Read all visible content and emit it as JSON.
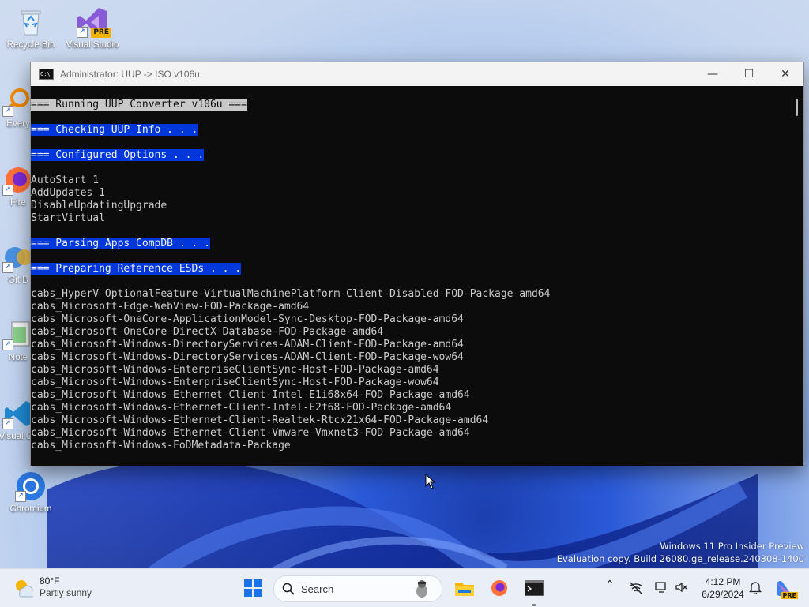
{
  "desktop": {
    "icons": [
      {
        "label": "Recycle Bin",
        "icon": "recycle-bin-icon"
      },
      {
        "label": "Visual Studio",
        "icon": "visual-studio-icon",
        "badge": "PRE"
      },
      {
        "label": "Every",
        "icon": "everything-icon"
      },
      {
        "label": "Fire",
        "icon": "firefox-icon"
      },
      {
        "label": "Git B",
        "icon": "git-bash-icon"
      },
      {
        "label": "Note",
        "icon": "notepad-icon"
      },
      {
        "label": "Visual Co",
        "icon": "vscode-icon"
      },
      {
        "label": "Chromium",
        "icon": "chromium-icon"
      }
    ],
    "watermark": {
      "line1": "Windows 11 Pro Insider Preview",
      "line2": "Evaluation copy. Build 26080.ge_release.240308-1400"
    }
  },
  "window": {
    "title": "Administrator:  UUP -> ISO v106u",
    "icon_text": "C:\\",
    "minimize": "—",
    "maximize": "☐",
    "close": "✕"
  },
  "console": {
    "lines": [
      {
        "text": "=== Running UUP Converter v106u ===",
        "style": "gray"
      },
      {
        "text": "",
        "style": ""
      },
      {
        "text": "=== Checking UUP Info . . .",
        "style": "blue"
      },
      {
        "text": "",
        "style": ""
      },
      {
        "text": "=== Configured Options . . .",
        "style": "blue"
      },
      {
        "text": "",
        "style": ""
      },
      {
        "text": "AutoStart 1",
        "style": ""
      },
      {
        "text": "AddUpdates 1",
        "style": ""
      },
      {
        "text": "DisableUpdatingUpgrade",
        "style": ""
      },
      {
        "text": "StartVirtual",
        "style": ""
      },
      {
        "text": "",
        "style": ""
      },
      {
        "text": "=== Parsing Apps CompDB . . .",
        "style": "blue"
      },
      {
        "text": "",
        "style": ""
      },
      {
        "text": "=== Preparing Reference ESDs . . .",
        "style": "blue"
      },
      {
        "text": "",
        "style": ""
      },
      {
        "text": "cabs_HyperV-OptionalFeature-VirtualMachinePlatform-Client-Disabled-FOD-Package-amd64",
        "style": ""
      },
      {
        "text": "cabs_Microsoft-Edge-WebView-FOD-Package-amd64",
        "style": ""
      },
      {
        "text": "cabs_Microsoft-OneCore-ApplicationModel-Sync-Desktop-FOD-Package-amd64",
        "style": ""
      },
      {
        "text": "cabs_Microsoft-OneCore-DirectX-Database-FOD-Package-amd64",
        "style": ""
      },
      {
        "text": "cabs_Microsoft-Windows-DirectoryServices-ADAM-Client-FOD-Package-amd64",
        "style": ""
      },
      {
        "text": "cabs_Microsoft-Windows-DirectoryServices-ADAM-Client-FOD-Package-wow64",
        "style": ""
      },
      {
        "text": "cabs_Microsoft-Windows-EnterpriseClientSync-Host-FOD-Package-amd64",
        "style": ""
      },
      {
        "text": "cabs_Microsoft-Windows-EnterpriseClientSync-Host-FOD-Package-wow64",
        "style": ""
      },
      {
        "text": "cabs_Microsoft-Windows-Ethernet-Client-Intel-E1i68x64-FOD-Package-amd64",
        "style": ""
      },
      {
        "text": "cabs_Microsoft-Windows-Ethernet-Client-Intel-E2f68-FOD-Package-amd64",
        "style": ""
      },
      {
        "text": "cabs_Microsoft-Windows-Ethernet-Client-Realtek-Rtcx21x64-FOD-Package-amd64",
        "style": ""
      },
      {
        "text": "cabs_Microsoft-Windows-Ethernet-Client-Vmware-Vmxnet3-FOD-Package-amd64",
        "style": ""
      },
      {
        "text": "cabs_Microsoft-Windows-FoDMetadata-Package",
        "style": ""
      }
    ]
  },
  "taskbar": {
    "weather": {
      "temp": "80°F",
      "condition": "Partly sunny"
    },
    "search_label": "Search",
    "clock": {
      "time": "4:12 PM",
      "date": "6/29/2024"
    },
    "copilot_badge": "PRE"
  },
  "colors": {
    "console_bg": "#0c0c0c",
    "console_fg": "#cccccc",
    "highlight_blue": "#0037da",
    "highlight_gray": "#c8c8c8"
  }
}
